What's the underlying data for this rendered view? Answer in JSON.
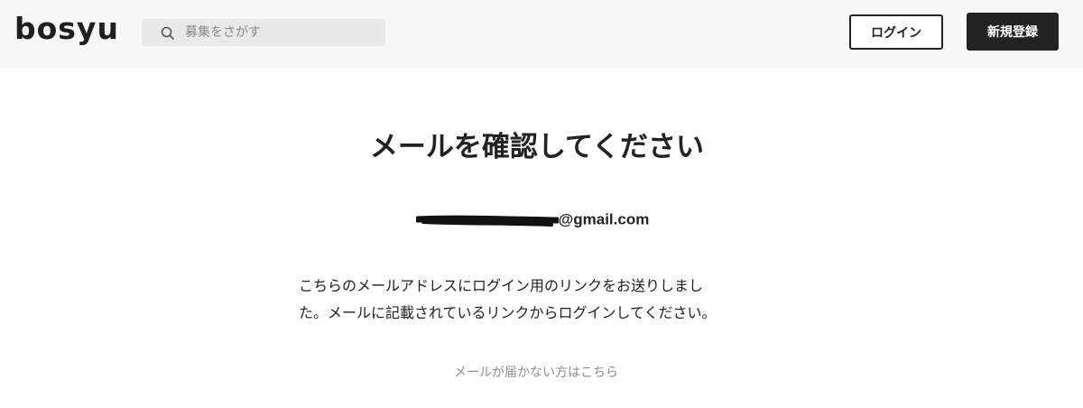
{
  "header": {
    "logo": "bosyu",
    "search": {
      "placeholder": "募集をさがす",
      "value": ""
    },
    "login_label": "ログイン",
    "signup_label": "新規登録"
  },
  "main": {
    "title": "メールを確認してください",
    "email_domain": "@gmail.com",
    "message_line1": "こちらのメールアドレスにログイン用のリンクをお送りしまし",
    "message_line2": "た。メールに記載されているリンクからログインしてください。",
    "help_link": "メールが届かない方はこちら"
  },
  "colors": {
    "header_bg": "#f7f7f7",
    "search_bg": "#e9e9e9",
    "primary": "#222222",
    "muted_text": "#8f8f8f"
  },
  "icons": {
    "search": "search-icon"
  }
}
